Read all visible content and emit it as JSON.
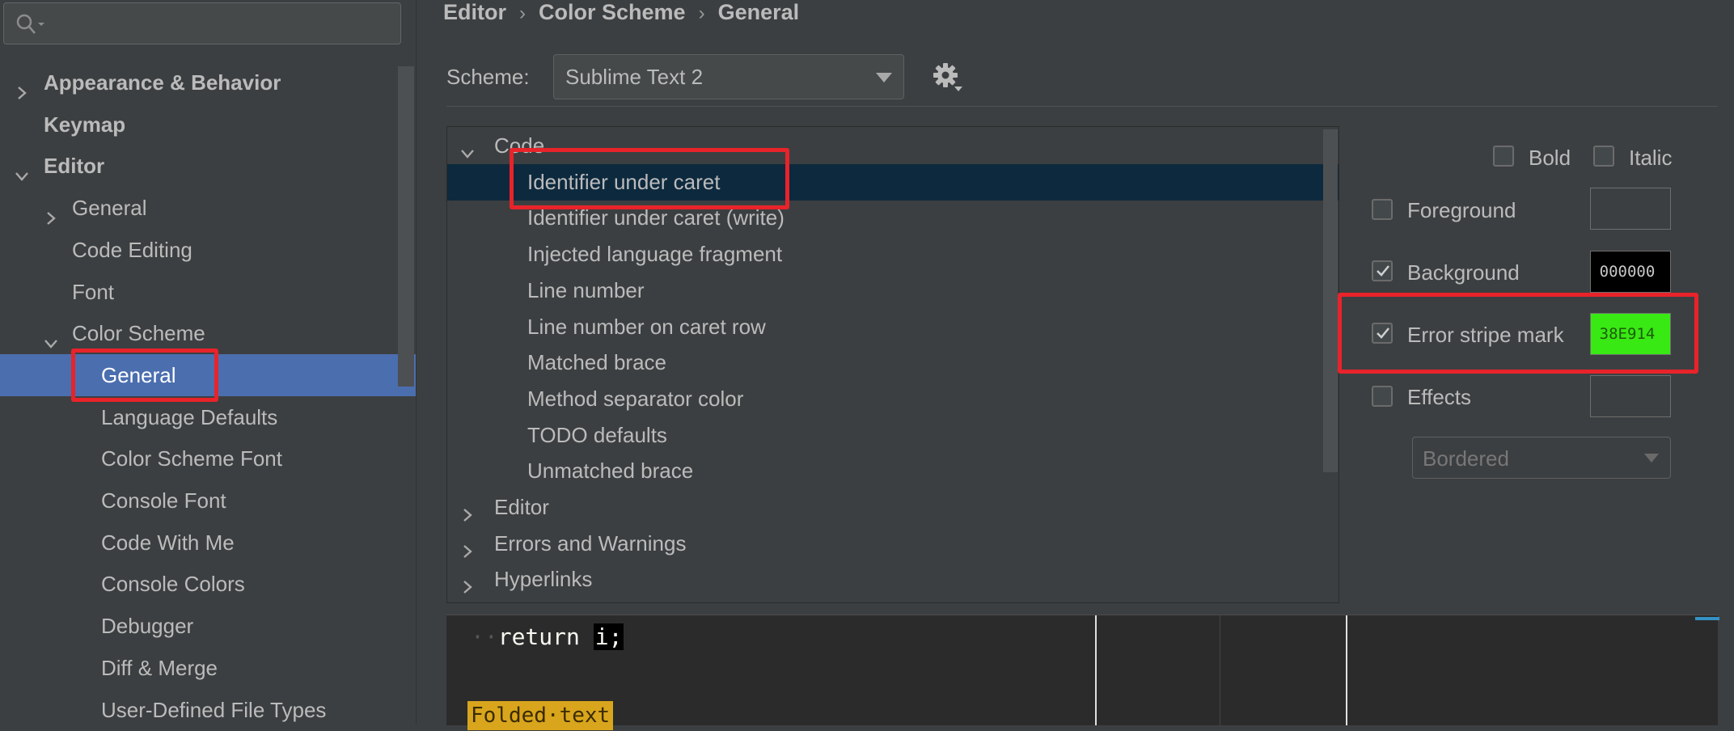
{
  "sidebar": {
    "search": {
      "placeholder": ""
    },
    "items": [
      {
        "label": "Appearance & Behavior",
        "bold": true,
        "chevron": "right"
      },
      {
        "label": "Keymap",
        "bold": true,
        "chevron": ""
      },
      {
        "label": "Editor",
        "bold": true,
        "chevron": "down"
      },
      {
        "label": "General",
        "bold": false,
        "chevron": "right"
      },
      {
        "label": "Code Editing",
        "bold": false,
        "chevron": ""
      },
      {
        "label": "Font",
        "bold": false,
        "chevron": ""
      },
      {
        "label": "Color Scheme",
        "bold": false,
        "chevron": "down"
      },
      {
        "label": "General",
        "bold": false,
        "chevron": "",
        "selected": true
      },
      {
        "label": "Language Defaults",
        "bold": false,
        "chevron": ""
      },
      {
        "label": "Color Scheme Font",
        "bold": false,
        "chevron": ""
      },
      {
        "label": "Console Font",
        "bold": false,
        "chevron": ""
      },
      {
        "label": "Code With Me",
        "bold": false,
        "chevron": ""
      },
      {
        "label": "Console Colors",
        "bold": false,
        "chevron": ""
      },
      {
        "label": "Debugger",
        "bold": false,
        "chevron": ""
      },
      {
        "label": "Diff & Merge",
        "bold": false,
        "chevron": ""
      },
      {
        "label": "User-Defined File Types",
        "bold": false,
        "chevron": ""
      }
    ]
  },
  "breadcrumb": [
    "Editor",
    "Color Scheme",
    "General"
  ],
  "scheme": {
    "label": "Scheme:",
    "value": "Sublime Text 2"
  },
  "tree": {
    "rows": [
      {
        "label": "Code",
        "chevron": "down",
        "level": 0
      },
      {
        "label": "Identifier under caret",
        "chevron": "",
        "level": 1,
        "selected": true
      },
      {
        "label": "Identifier under caret (write)",
        "chevron": "",
        "level": 1
      },
      {
        "label": "Injected language fragment",
        "chevron": "",
        "level": 1
      },
      {
        "label": "Line number",
        "chevron": "",
        "level": 1
      },
      {
        "label": "Line number on caret row",
        "chevron": "",
        "level": 1
      },
      {
        "label": "Matched brace",
        "chevron": "",
        "level": 1
      },
      {
        "label": "Method separator color",
        "chevron": "",
        "level": 1
      },
      {
        "label": "TODO defaults",
        "chevron": "",
        "level": 1
      },
      {
        "label": "Unmatched brace",
        "chevron": "",
        "level": 1
      },
      {
        "label": "Editor",
        "chevron": "right",
        "level": 0
      },
      {
        "label": "Errors and Warnings",
        "chevron": "right",
        "level": 0
      },
      {
        "label": "Hyperlinks",
        "chevron": "right",
        "level": 0
      }
    ]
  },
  "attributes": {
    "bold_label": "Bold",
    "italic_label": "Italic",
    "bold_checked": false,
    "italic_checked": false,
    "foreground": {
      "label": "Foreground",
      "checked": false,
      "value": "",
      "color": ""
    },
    "background": {
      "label": "Background",
      "checked": true,
      "value": "000000",
      "color": "#000000"
    },
    "error_stripe": {
      "label": "Error stripe mark",
      "checked": true,
      "value": "38E914",
      "color": "#38e914"
    },
    "effects": {
      "label": "Effects",
      "checked": false,
      "value": "",
      "color": ""
    },
    "effect_type": "Bordered"
  },
  "preview": {
    "indent": "··",
    "keyword": "return",
    "identifier": "i",
    "semicolon": ";",
    "folded_text": "Folded·text"
  },
  "icons": [
    "search-icon",
    "chevron-right-icon",
    "chevron-down-icon",
    "gear-icon",
    "checkmark-icon",
    "dropdown-arrow-icon"
  ]
}
